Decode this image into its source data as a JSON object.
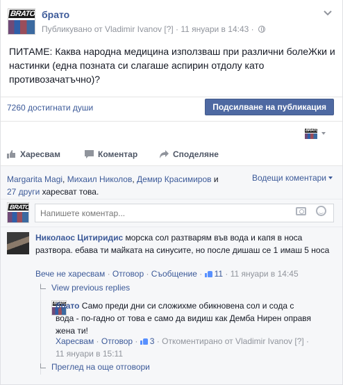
{
  "post": {
    "page_name": "брато",
    "published_by": "Публикувано от Vladimir Ivanov",
    "help_marker": "[?]",
    "dot": "·",
    "timestamp": "11 януари в 14:43",
    "text": "ПИТАМЕ: Каква народна медицина използваш при различни болеЖки и настинки (една позната си слагаше аспирин отдолу като противозачатъчно)?",
    "avatar_label": "BRATO"
  },
  "reach": {
    "text": "7260 достигнати души",
    "boost_label": "Подсилване на публикация"
  },
  "actions": {
    "like": "Харесвам",
    "comment": "Коментар",
    "share": "Споделяне"
  },
  "likes": {
    "name1": "Margarita Magi",
    "sep1": ", ",
    "name2": "Михаил Николов",
    "sep2": ", ",
    "name3": "Демир Красимиров",
    "and": " и",
    "others": "27 други",
    "suffix": " харесват това.",
    "sort_label": "Водещи коментари"
  },
  "composer": {
    "placeholder": "Напишете коментар..."
  },
  "comment1": {
    "author": "Николаос Цитиридис",
    "text": " морска сол разтварям във вода и капя в носа разтвора. ебава ти майката на синусите, но после дишаш се 1 имаш 5 носа",
    "unlike": "Вече не харесвам",
    "reply": "Отговор",
    "message": "Съобщение",
    "like_count": "11",
    "sep": " · ",
    "time": "11 януари в 14:45",
    "view_previous": "View previous replies"
  },
  "reply1": {
    "author": "брато",
    "text": " Само преди дни си сложихме обикновена сол и сода с вода - по-гадно от това е само да видиш как Демба Нирен оправя жена ти!",
    "like": "Харесвам",
    "reply": "Отговор",
    "like_count": "3",
    "edited_by": "Откоментирано от Vladimir Ivanov",
    "help_marker": "[?]",
    "time": "11 януари в 15:11",
    "more_replies": "Преглед на още отговори"
  }
}
